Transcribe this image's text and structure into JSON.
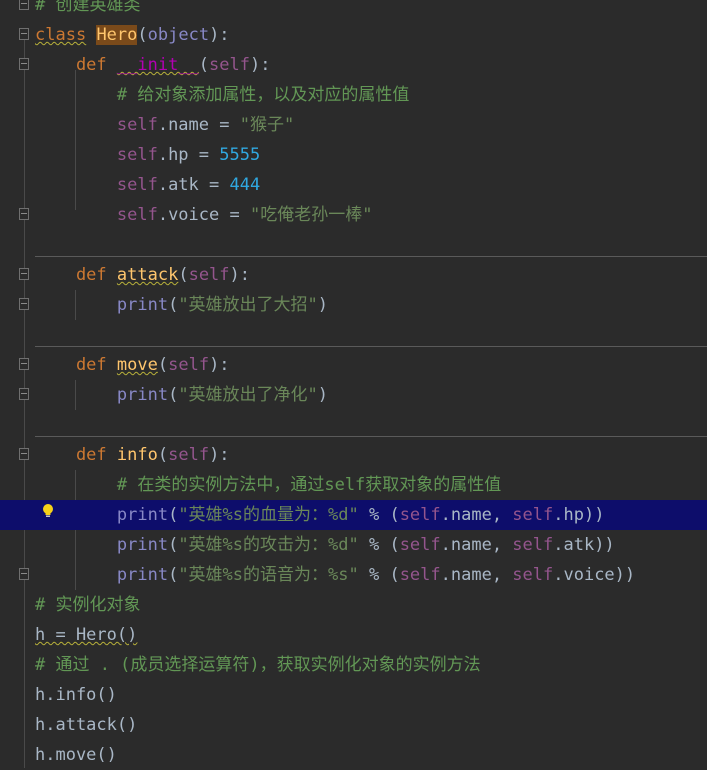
{
  "editor": {
    "lines": [
      {
        "segments": [
          {
            "t": "# 创建英雄类",
            "c": "cmt"
          }
        ]
      },
      {
        "segments": [
          {
            "t": "class",
            "c": "kw squiggle"
          },
          {
            "t": " "
          },
          {
            "t": "Hero",
            "c": "cls-hl"
          },
          {
            "t": "("
          },
          {
            "t": "object",
            "c": "builtin"
          },
          {
            "t": "):"
          }
        ]
      },
      {
        "segments": [
          {
            "t": "    def",
            "c": "kw"
          },
          {
            "t": " "
          },
          {
            "t": "__init__",
            "c": "magic squiggle"
          },
          {
            "t": "("
          },
          {
            "t": "self",
            "c": "self"
          },
          {
            "t": "):"
          }
        ]
      },
      {
        "segments": [
          {
            "t": "        # 给对象添加属性，以及对应的属性值",
            "c": "cmt"
          }
        ]
      },
      {
        "segments": [
          {
            "t": "        self",
            "c": "self"
          },
          {
            "t": ".name = "
          },
          {
            "t": "\"猴子\"",
            "c": "str"
          }
        ]
      },
      {
        "segments": [
          {
            "t": "        self",
            "c": "self"
          },
          {
            "t": ".hp = "
          },
          {
            "t": "5555",
            "c": "num"
          }
        ]
      },
      {
        "segments": [
          {
            "t": "        self",
            "c": "self"
          },
          {
            "t": ".atk = "
          },
          {
            "t": "444",
            "c": "num"
          }
        ]
      },
      {
        "segments": [
          {
            "t": "        self",
            "c": "self"
          },
          {
            "t": ".voice = "
          },
          {
            "t": "\"吃俺老孙一棒\"",
            "c": "str"
          }
        ]
      },
      {
        "segments": []
      },
      {
        "segments": [
          {
            "t": "    def",
            "c": "kw"
          },
          {
            "t": " "
          },
          {
            "t": "attack",
            "c": "fn squiggle"
          },
          {
            "t": "("
          },
          {
            "t": "self",
            "c": "self"
          },
          {
            "t": "):"
          }
        ]
      },
      {
        "segments": [
          {
            "t": "        print",
            "c": "builtin"
          },
          {
            "t": "("
          },
          {
            "t": "\"英雄放出了大招\"",
            "c": "str"
          },
          {
            "t": ")"
          }
        ]
      },
      {
        "segments": []
      },
      {
        "segments": [
          {
            "t": "    def",
            "c": "kw"
          },
          {
            "t": " "
          },
          {
            "t": "move",
            "c": "fn squiggle"
          },
          {
            "t": "("
          },
          {
            "t": "self",
            "c": "self"
          },
          {
            "t": "):"
          }
        ]
      },
      {
        "segments": [
          {
            "t": "        print",
            "c": "builtin"
          },
          {
            "t": "("
          },
          {
            "t": "\"英雄放出了净化\"",
            "c": "str"
          },
          {
            "t": ")"
          }
        ]
      },
      {
        "segments": []
      },
      {
        "segments": [
          {
            "t": "    def",
            "c": "kw"
          },
          {
            "t": " "
          },
          {
            "t": "info",
            "c": "fn"
          },
          {
            "t": "("
          },
          {
            "t": "self",
            "c": "self"
          },
          {
            "t": "):"
          }
        ]
      },
      {
        "segments": [
          {
            "t": "        # 在类的实例方法中，通过self获取对象的属性值",
            "c": "cmt"
          }
        ]
      },
      {
        "segments": [
          {
            "t": "        print",
            "c": "builtin"
          },
          {
            "t": "("
          },
          {
            "t": "\"英雄%s的血量为：%d\"",
            "c": "str"
          },
          {
            "t": " % ("
          },
          {
            "t": "self",
            "c": "self"
          },
          {
            "t": ".name, ",
            "c": ""
          },
          {
            "t": "self",
            "c": "self"
          },
          {
            "t": ".hp))"
          }
        ]
      },
      {
        "segments": [
          {
            "t": "        print",
            "c": "builtin"
          },
          {
            "t": "("
          },
          {
            "t": "\"英雄%s的攻击为：%d\"",
            "c": "str"
          },
          {
            "t": " % ("
          },
          {
            "t": "self",
            "c": "self"
          },
          {
            "t": ".name, "
          },
          {
            "t": "self",
            "c": "self"
          },
          {
            "t": ".atk))"
          }
        ]
      },
      {
        "segments": [
          {
            "t": "        print",
            "c": "builtin"
          },
          {
            "t": "("
          },
          {
            "t": "\"英雄%s的语音为：%s\"",
            "c": "str"
          },
          {
            "t": " % ("
          },
          {
            "t": "self",
            "c": "self"
          },
          {
            "t": ".name, "
          },
          {
            "t": "self",
            "c": "self"
          },
          {
            "t": ".voice))"
          }
        ]
      },
      {
        "segments": [
          {
            "t": "# 实例化对象",
            "c": "cmt"
          }
        ]
      },
      {
        "segments": [
          {
            "t": "h = Hero()",
            "c": "squiggle"
          }
        ]
      },
      {
        "segments": [
          {
            "t": "# 通过 . (成员选择运算符)，获取实例化对象的实例方法",
            "c": "cmt"
          }
        ]
      },
      {
        "segments": [
          {
            "t": "h.info()"
          }
        ]
      },
      {
        "segments": [
          {
            "t": "h.attack()"
          }
        ]
      },
      {
        "segments": [
          {
            "t": "h.move()"
          }
        ]
      }
    ],
    "highlighted_line": 17,
    "icons": {
      "bulb": "lightbulb-icon",
      "fold": "fold-marker-icon"
    },
    "colors": {
      "background": "#2b2b2b",
      "highlight": "#0d0d6b",
      "keyword": "#cc7832",
      "string": "#6a8759",
      "number": "#30a8e0",
      "comment": "#629755",
      "self": "#94558d"
    }
  }
}
